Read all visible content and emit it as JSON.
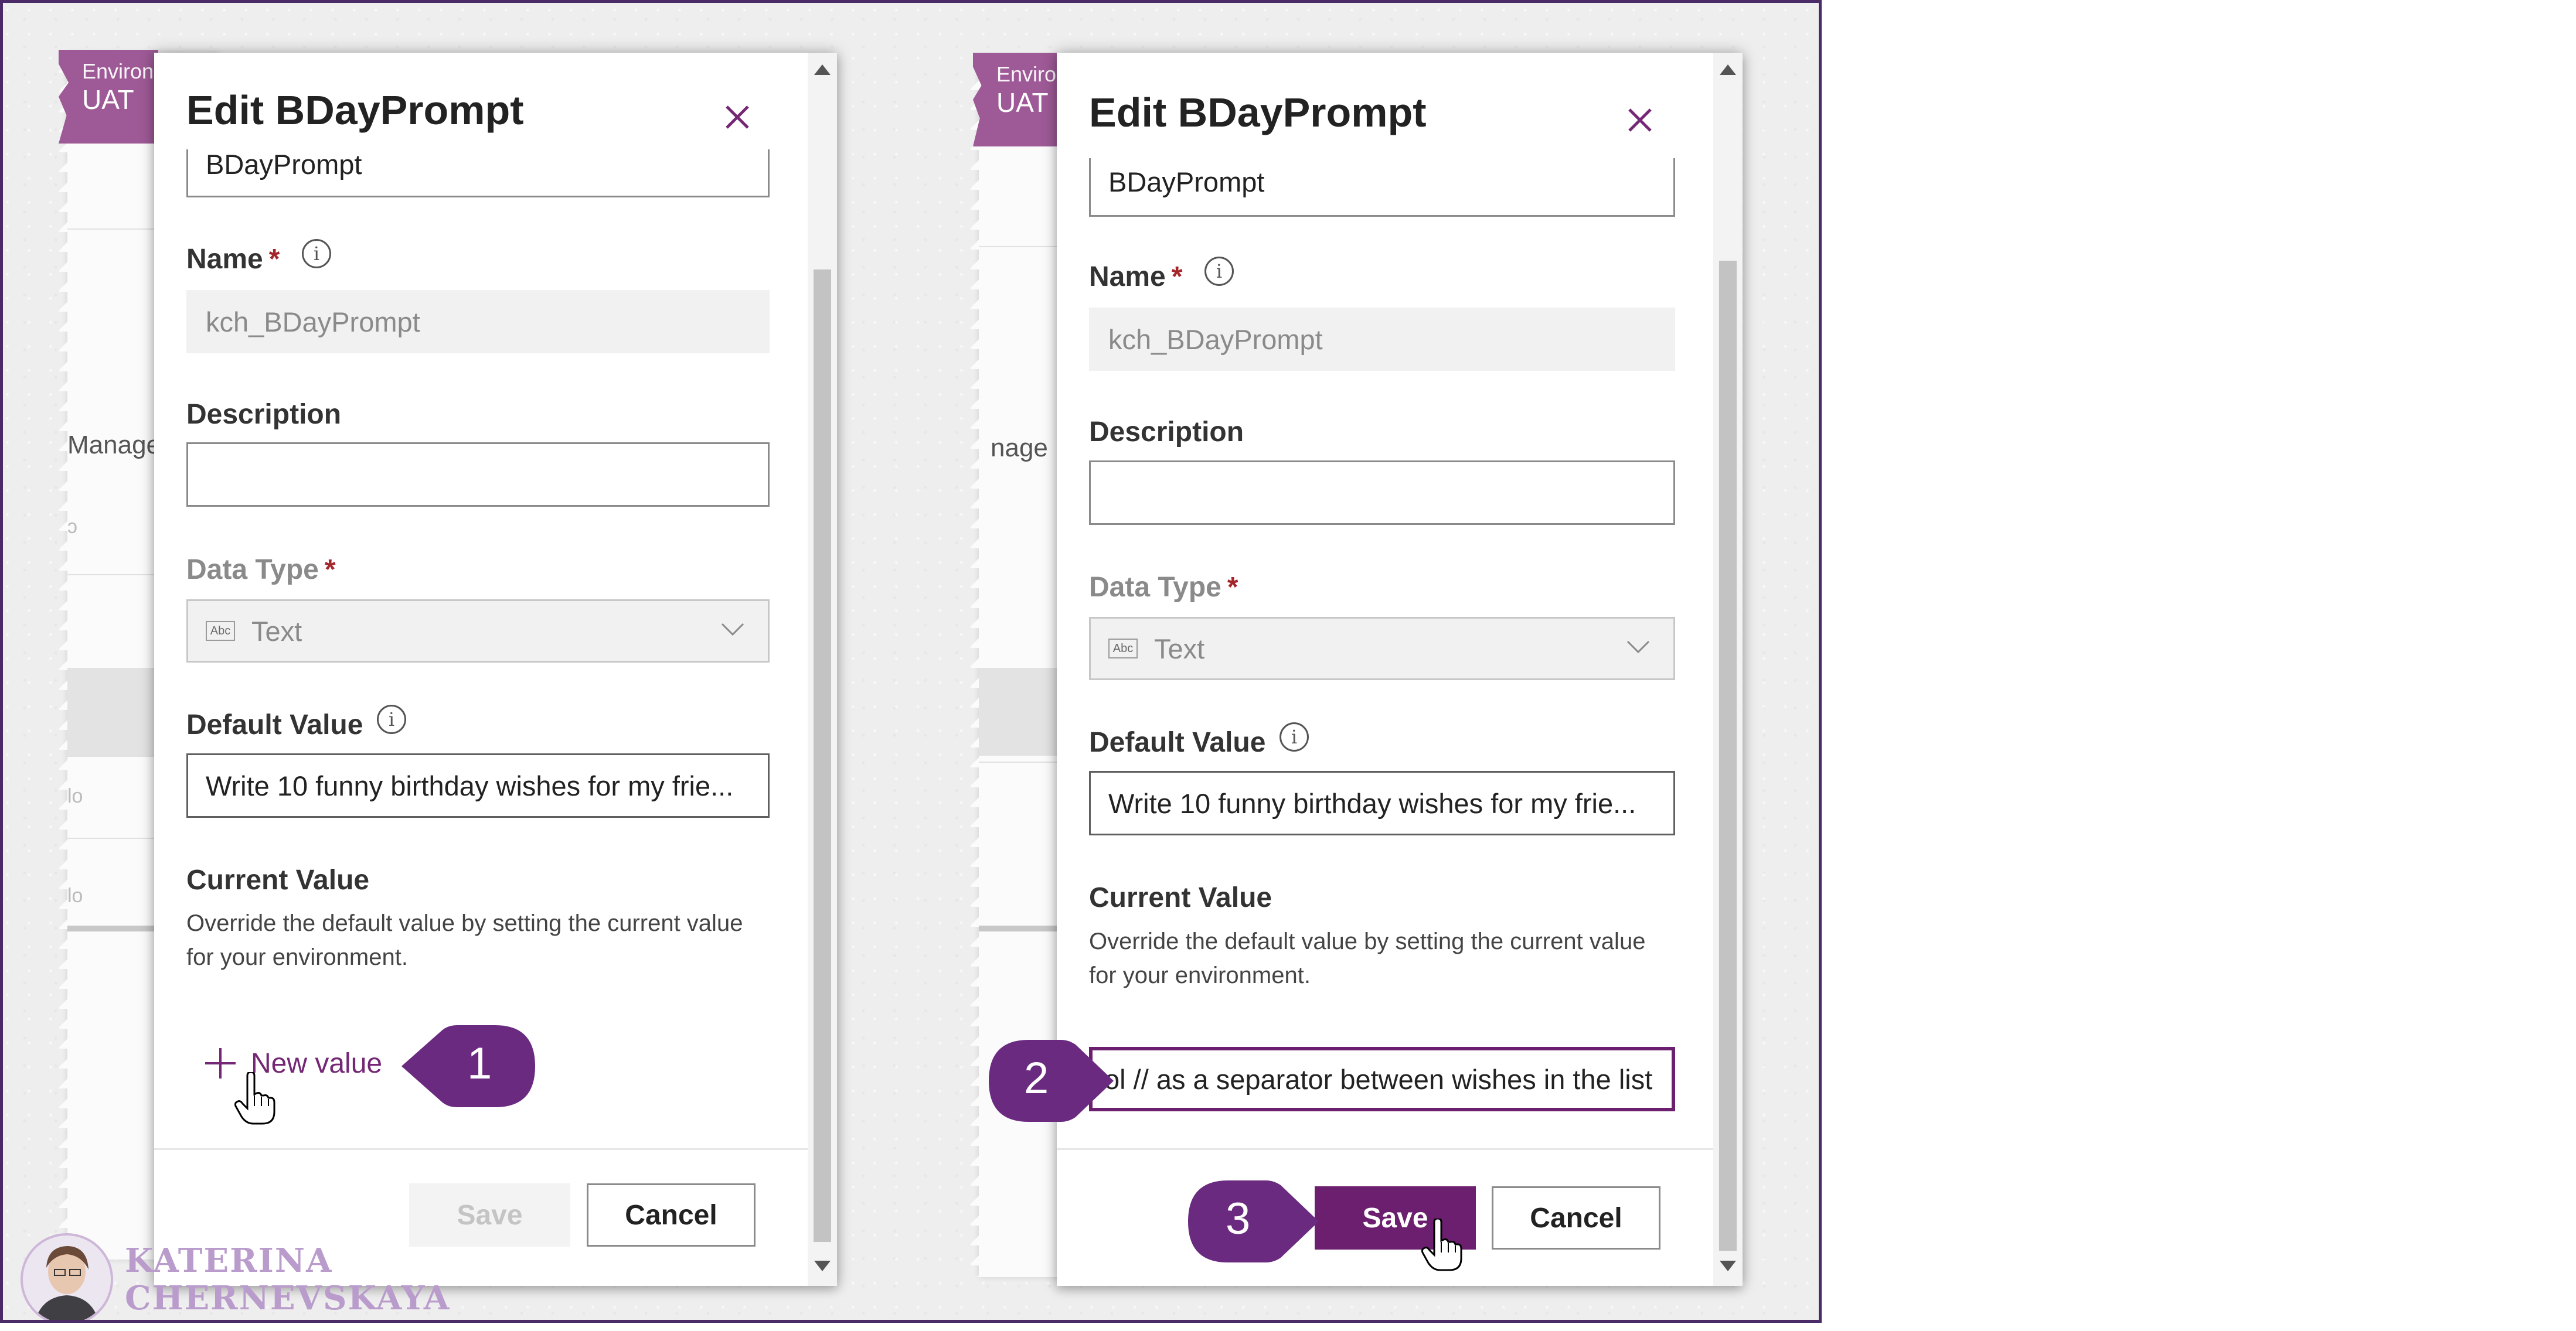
{
  "background": {
    "env_label": "Environ",
    "env_name": "UAT",
    "nav_fragment_left": "Manage",
    "nav_fragment_right": "nage"
  },
  "panels": [
    {
      "title": "Edit BDayPrompt",
      "display_name_value": "BDayPrompt",
      "name_label": "Name",
      "name_value": "kch_BDayPrompt",
      "description_label": "Description",
      "description_value": "",
      "data_type_label": "Data Type",
      "data_type_value": "Text",
      "default_value_label": "Default Value",
      "default_value": "Write 10 funny birthday wishes for my frie...",
      "current_value_label": "Current Value",
      "current_value_help": "Override the default value by setting the current value for your environment.",
      "new_value_label": "New value",
      "save_label": "Save",
      "cancel_label": "Cancel"
    },
    {
      "title": "Edit BDayPrompt",
      "display_name_value": "BDayPrompt",
      "name_label": "Name",
      "name_value": "kch_BDayPrompt",
      "description_label": "Description",
      "description_value": "",
      "data_type_label": "Data Type",
      "data_type_value": "Text",
      "default_value_label": "Default Value",
      "default_value": "Write 10 funny birthday wishes for my frie...",
      "current_value_label": "Current Value",
      "current_value_help": "Override the default value by setting the current value for your environment.",
      "current_value_input": "ol // as a separator between wishes in the list",
      "save_label": "Save",
      "cancel_label": "Cancel"
    }
  ],
  "callouts": [
    "1",
    "2",
    "3"
  ],
  "author": {
    "line1": "KATERINA",
    "line2": "CHERNEVSKAYA"
  },
  "colors": {
    "primary": "#6b1f6e",
    "callout": "#6a2a7f",
    "env_badge": "#9e5a96",
    "frame": "#4b2a68"
  },
  "icons": [
    "close-icon",
    "info-icon",
    "text-type-icon",
    "chevron-down-icon",
    "plus-icon",
    "hand-cursor-icon"
  ]
}
